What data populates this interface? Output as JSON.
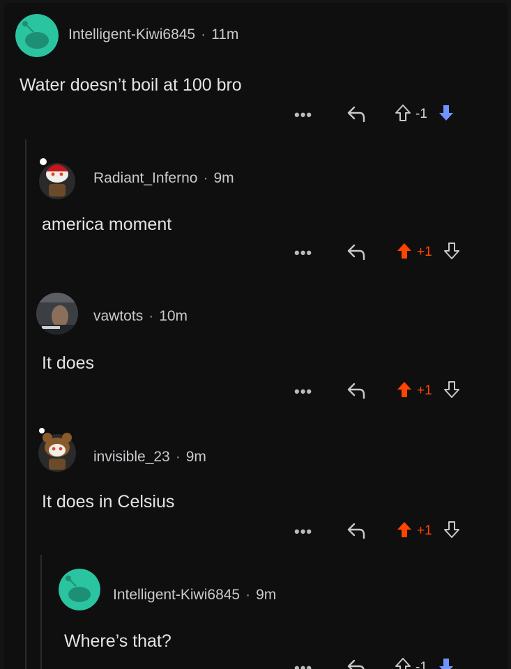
{
  "comments": [
    {
      "username": "Intelligent-Kiwi6845",
      "time": "11m",
      "body": "Water doesn’t boil at 100 bro",
      "score": "-1",
      "vote": "down",
      "avatar": "kiwi-snoo-icon"
    },
    {
      "username": "Radiant_Inferno",
      "time": "9m",
      "body": "america moment",
      "score": "+1",
      "vote": "up",
      "avatar": "santa-snoo-icon"
    },
    {
      "username": "vawtots",
      "time": "10m",
      "body": "It does",
      "score": "+1",
      "vote": "up",
      "avatar": "photo-avatar"
    },
    {
      "username": "invisible_23",
      "time": "9m",
      "body": "It does in Celsius",
      "score": "+1",
      "vote": "up",
      "avatar": "bear-snoo-icon"
    },
    {
      "username": "Intelligent-Kiwi6845",
      "time": "9m",
      "body": "Where’s that?",
      "score": "-1",
      "vote": "down",
      "avatar": "kiwi-snoo-icon"
    }
  ],
  "ui": {
    "separator": "·",
    "more_label": "•••"
  },
  "colors": {
    "upvote": "#ff4500",
    "downvote": "#7193ff",
    "neutral": "#d7dadc",
    "background": "#0f0f10",
    "avatar_teal": "#2bc4a0"
  }
}
